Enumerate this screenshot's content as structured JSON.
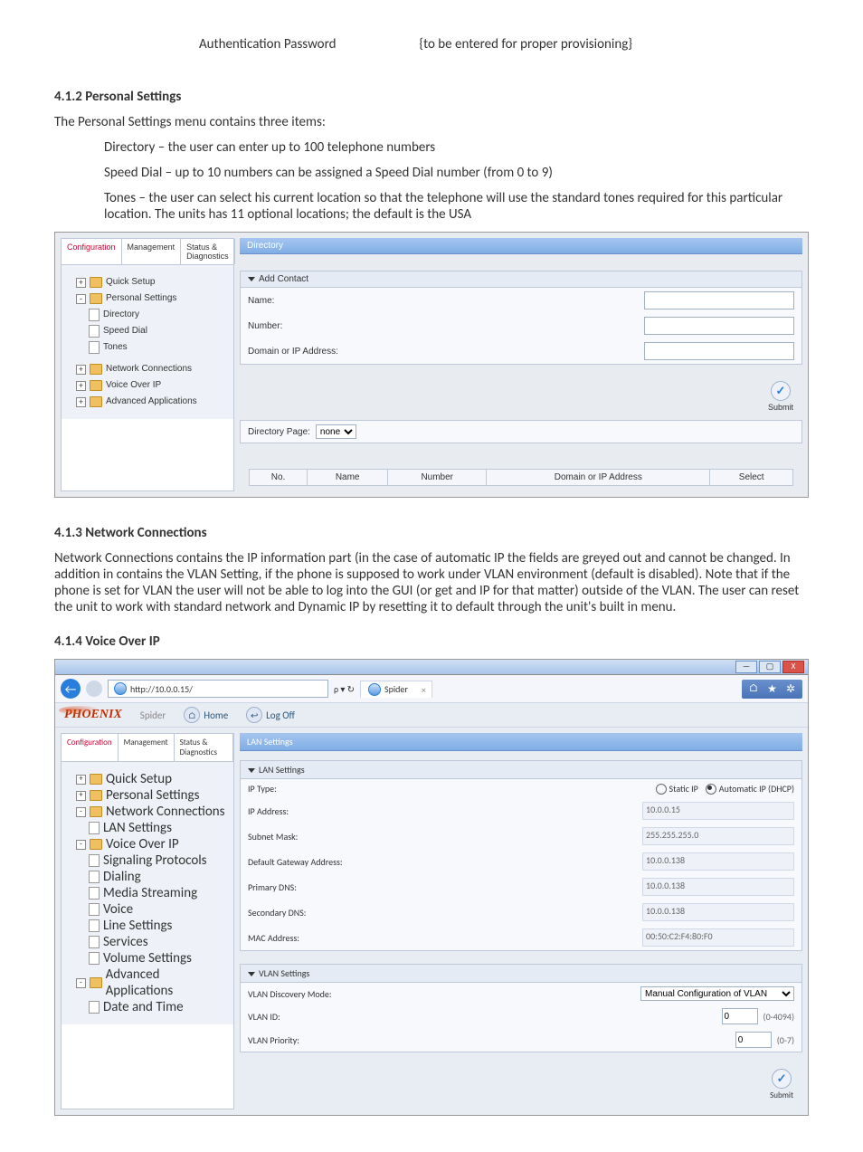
{
  "intro": {
    "auth_label": "Authentication Password",
    "auth_value": "{to be entered for proper provisioning}"
  },
  "s412": {
    "title": "4.1.2 Personal Settings",
    "lead": "The Personal Settings menu contains three items:",
    "bullet1": "Directory – the user can enter up to 100 telephone numbers",
    "bullet2": "Speed Dial – up to 10 numbers can be assigned a Speed Dial number (from 0 to 9)",
    "bullet3": "Tones – the user can select his current location so that the telephone will use the standard tones required for this particular location. The units has 11 optional locations; the default is the USA"
  },
  "shot1": {
    "title": "Directory",
    "tabs": {
      "a": "Configuration",
      "b": "Management",
      "c": "Status & Diagnostics"
    },
    "tree": {
      "quick": "Quick Setup",
      "personal": "Personal Settings",
      "dir": "Directory",
      "speed": "Speed Dial",
      "tones": "Tones",
      "net": "Network Connections",
      "voip": "Voice Over IP",
      "adv": "Advanced Applications"
    },
    "form": {
      "head": "Add Contact",
      "name": "Name:",
      "number": "Number:",
      "domain": "Domain or IP Address:"
    },
    "dirpage": {
      "label": "Directory Page:",
      "value": "none"
    },
    "table": {
      "no": "No.",
      "name": "Name",
      "number": "Number",
      "domain": "Domain or IP Address",
      "select": "Select"
    },
    "submit": "Submit"
  },
  "s413": {
    "title": "4.1.3 Network Connections",
    "para": "Network Connections contains the IP information part (in the case of automatic IP the fields are greyed out and cannot be changed. In addition in contains the VLAN Setting, if the phone is supposed to work under VLAN environment (default is disabled). Note that if the phone is set for VLAN the user will not be able to log into the GUI (or get and IP for that matter) outside of the VLAN. The user can reset the unit to work with standard network and Dynamic IP by resetting it to default through the unit's built in menu."
  },
  "s414": {
    "title": "4.1.4 Voice Over IP"
  },
  "shot2": {
    "url": "http://10.0.0.15/",
    "search_icons": "ρ ▾ ↻",
    "tab": "Spider",
    "win": {
      "min": "—",
      "max": "▢",
      "close": "X",
      "home": "⌂",
      "star": "★",
      "gear": "✲"
    },
    "header": {
      "logo": "PHOENIX",
      "spider": "Spider",
      "home": "Home",
      "logoff": "Log Off"
    },
    "tabs": {
      "a": "Configuration",
      "b": "Management",
      "c": "Status & Diagnostics"
    },
    "tree": {
      "quick": "Quick Setup",
      "personal": "Personal Settings",
      "net": "Network Connections",
      "lan": "LAN Settings",
      "voip": "Voice Over IP",
      "sig": "Signaling Protocols",
      "dial": "Dialing",
      "media": "Media Streaming",
      "voice": "Voice",
      "line": "Line Settings",
      "services": "Services",
      "volume": "Volume Settings",
      "adv": "Advanced Applications",
      "dt": "Date and Time"
    },
    "panel_title": "LAN Settings",
    "lan": {
      "head": "LAN Settings",
      "iptype_label": "IP Type:",
      "static": "Static IP",
      "dhcp": "Automatic IP (DHCP)",
      "ip_label": "IP Address:",
      "ip": "10.0.0.15",
      "mask_label": "Subnet Mask:",
      "mask": "255.255.255.0",
      "gw_label": "Default Gateway Address:",
      "gw": "10.0.0.138",
      "dns1_label": "Primary DNS:",
      "dns1": "10.0.0.138",
      "dns2_label": "Secondary DNS:",
      "dns2": "10.0.0.138",
      "mac_label": "MAC Address:",
      "mac": "00:50:C2:F4:80:F0"
    },
    "vlan": {
      "head": "VLAN Settings",
      "mode_label": "VLAN Discovery Mode:",
      "mode_value": "Manual Configuration of VLAN",
      "id_label": "VLAN ID:",
      "id_value": "0",
      "id_hint": "(0-4094)",
      "prio_label": "VLAN Priority:",
      "prio_value": "0",
      "prio_hint": "(0-7)"
    },
    "submit": "Submit"
  }
}
